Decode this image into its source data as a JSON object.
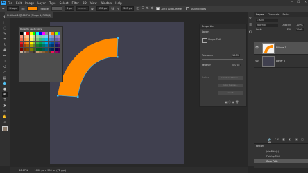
{
  "menu": {
    "logo": "Ps",
    "items": [
      "File",
      "Edit",
      "Image",
      "Layer",
      "Type",
      "Select",
      "Filter",
      "3D",
      "View",
      "Window",
      "Help"
    ]
  },
  "options": {
    "mode": "Shape",
    "fill_label": "Fill:",
    "stroke_label": "Stroke:",
    "stroke_width": "3 px",
    "w_label": "W:",
    "w_value": "350 px",
    "h_label": "H:",
    "h_value": "365 px",
    "auto_add": "Auto Add/Delete",
    "align_edges": "Align Edges"
  },
  "document": {
    "tab_title": "Untitled-1 @ 66.7% (Shape 1, RGB/8)"
  },
  "swatches": {
    "header": "Recently used colors",
    "colors": [
      "#000000",
      "#ffffff",
      "#ff0000",
      "#ffff00",
      "#00ff00",
      "#00ffff",
      "#0000ff",
      "#ff00ff",
      "#8c8c8c",
      "#c8c8c8",
      "#ff8000",
      "#80ff00",
      "#0080ff",
      "#f7977a",
      "#f9ad81",
      "#fdc68a",
      "#fff79a",
      "#c4df9b",
      "#a2d39c",
      "#82ca9d",
      "#7bcdc8",
      "#6ecff6",
      "#7ea7d8",
      "#8493ca",
      "#8882be",
      "#a187be",
      "#f26c4f",
      "#f68e55",
      "#fbaf5c",
      "#fff467",
      "#acd372",
      "#7cc576",
      "#3bb878",
      "#1abbb4",
      "#00bff3",
      "#438ccb",
      "#5574b9",
      "#605ca8",
      "#855fa8",
      "#ed1c24",
      "#f26522",
      "#f7941d",
      "#fff200",
      "#8dc73f",
      "#39b54a",
      "#00a651",
      "#00a99d",
      "#00aeef",
      "#0072bc",
      "#0054a6",
      "#2e3192",
      "#662d91",
      "#9e0b0f",
      "#a0410d",
      "#a36209",
      "#aba000",
      "#598527",
      "#1a7b30",
      "#007236",
      "#00746b",
      "#0076a3",
      "#004b80",
      "#003471",
      "#1b1464",
      "#440e62",
      "#790000",
      "#7b2e00",
      "#7d4900",
      "#827b00",
      "#406618",
      "#005e20",
      "#005826",
      "#005952",
      "#005b7f",
      "#003663",
      "#002157",
      "#0d004c",
      "#32004b",
      "#c7b299",
      "#998675",
      "#736357",
      "#534741",
      "#37302d",
      "#c69c6d",
      "#a67c52",
      "#8c6239",
      "#754c24",
      "#603913",
      "#ed145b",
      "#9e005d",
      "#630460"
    ]
  },
  "properties": {
    "title": "Properties",
    "tab_label": "Layers",
    "path_name": "Shape Path",
    "tolerance_label": "Tolerance",
    "tolerance_value": "100%",
    "feather_label": "Feather",
    "feather_value": "0.0 px",
    "btn_select_mask": "Select and Mask...",
    "btn_color_range": "Color Range...",
    "btn_invert": "Invert",
    "refine_label": "Refine"
  },
  "layers": {
    "tabs": [
      "Layers",
      "Channels",
      "Paths"
    ],
    "search_placeholder": "Kind",
    "blend": "Normal",
    "opacity_label": "Opacity:",
    "opacity_value": "100%",
    "lock_label": "Lock:",
    "fill_label": "Fill:",
    "fill_value": "100%",
    "items": [
      {
        "name": "Ellipse 1"
      },
      {
        "name": "Layer 0"
      }
    ]
  },
  "history": {
    "title": "History",
    "items": [
      "Join Path(s)",
      "Pick Up Path",
      "Clear Path"
    ]
  },
  "status": {
    "zoom": "66.67%",
    "doc_info": "1000 px x 990 px (72 ppi)"
  },
  "colors": {
    "shape_fill": "#ff8a00",
    "anchor": "#39b6f0",
    "doc_bg": "#40404f"
  },
  "icons": {
    "tools": [
      "move",
      "marquee",
      "lasso",
      "quick-select",
      "crop",
      "eyedropper",
      "healing",
      "brush",
      "stamp",
      "history-brush",
      "eraser",
      "gradient",
      "blur",
      "dodge",
      "pen",
      "type",
      "path-select",
      "rectangle",
      "hand",
      "zoom"
    ]
  }
}
